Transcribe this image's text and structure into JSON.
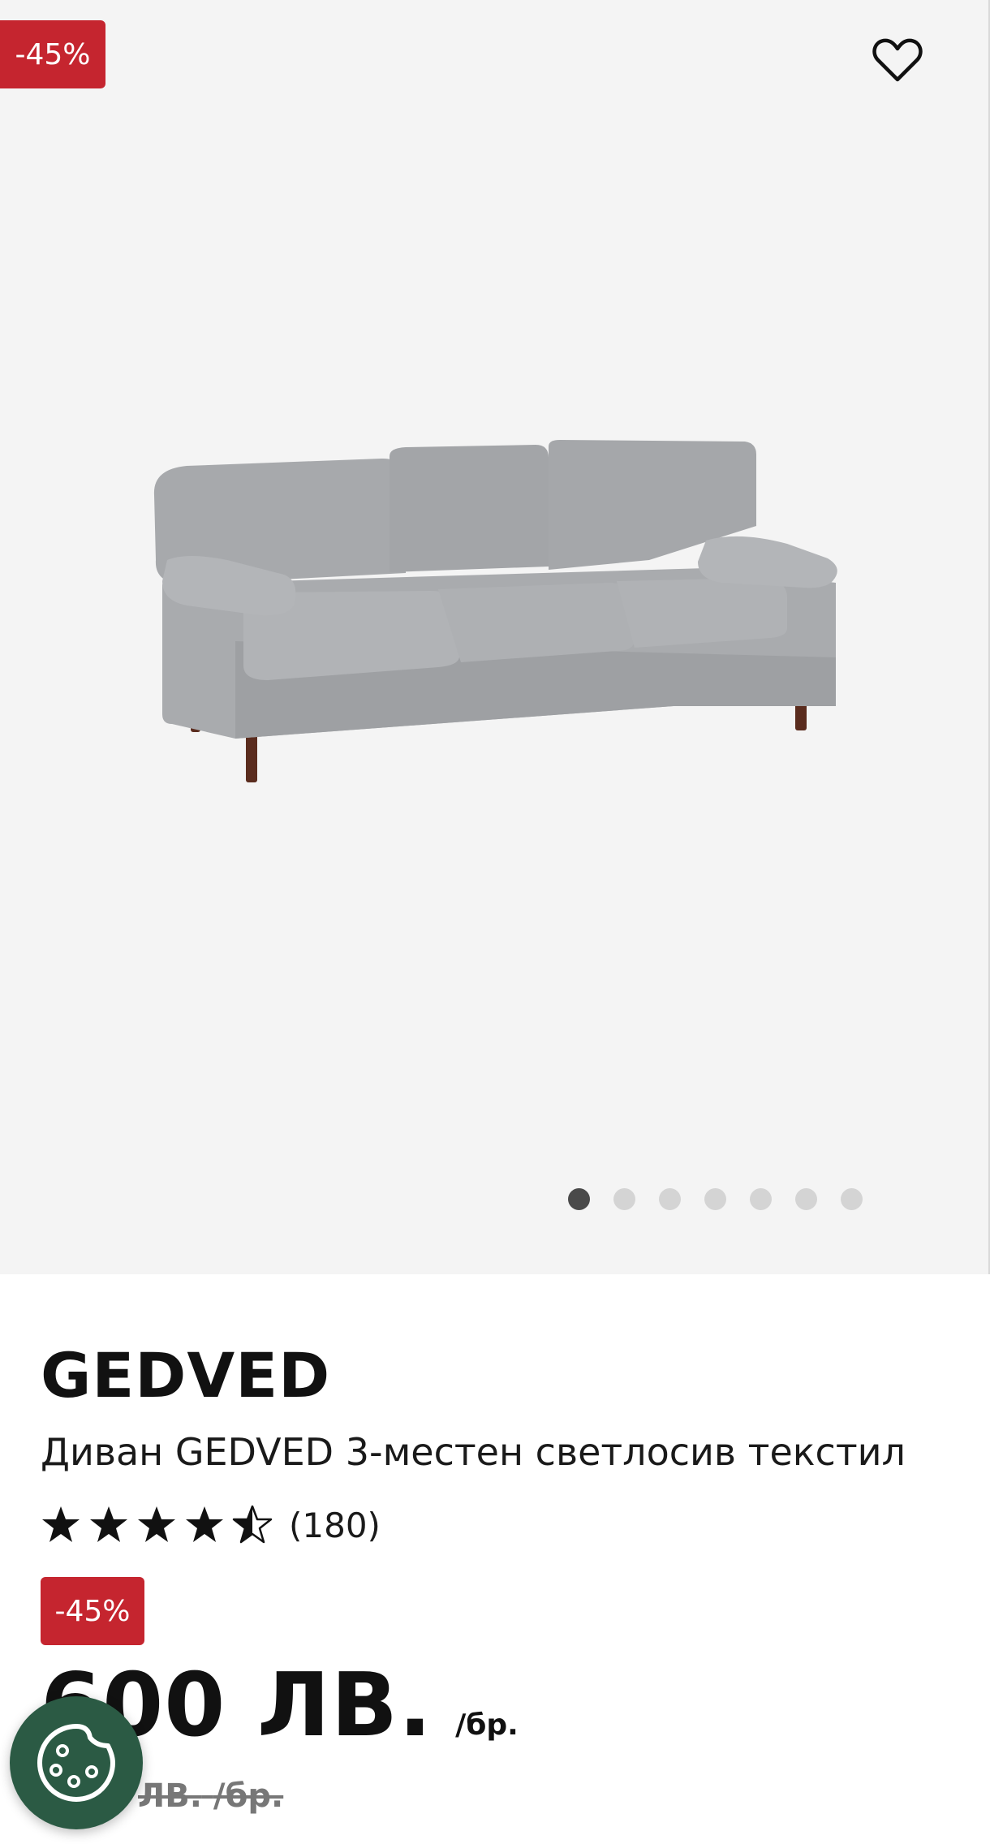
{
  "gallery": {
    "discount_badge": "-45%",
    "favorite_icon": "heart-outline-icon",
    "total_images": 7,
    "active_image_index": 0
  },
  "product": {
    "brand": "GEDVED",
    "title": "Диван GEDVED 3-местен светлосив текстил",
    "rating": {
      "value": 4.5,
      "max": 5,
      "count_label": "(180)"
    },
    "discount_badge": "-45%",
    "price": {
      "amount": "600 ЛВ.",
      "unit": "/бр."
    },
    "old_price": {
      "amount_visible": "ЛВ.",
      "unit": "/бр."
    }
  },
  "cookie_button": {
    "icon": "cookie-icon"
  },
  "colors": {
    "badge_red": "#c5252f",
    "cookie_green": "#2b5a44",
    "gallery_bg": "#f4f4f4",
    "dot_active": "#4a4a4a",
    "dot_inactive": "#d4d4d4"
  }
}
